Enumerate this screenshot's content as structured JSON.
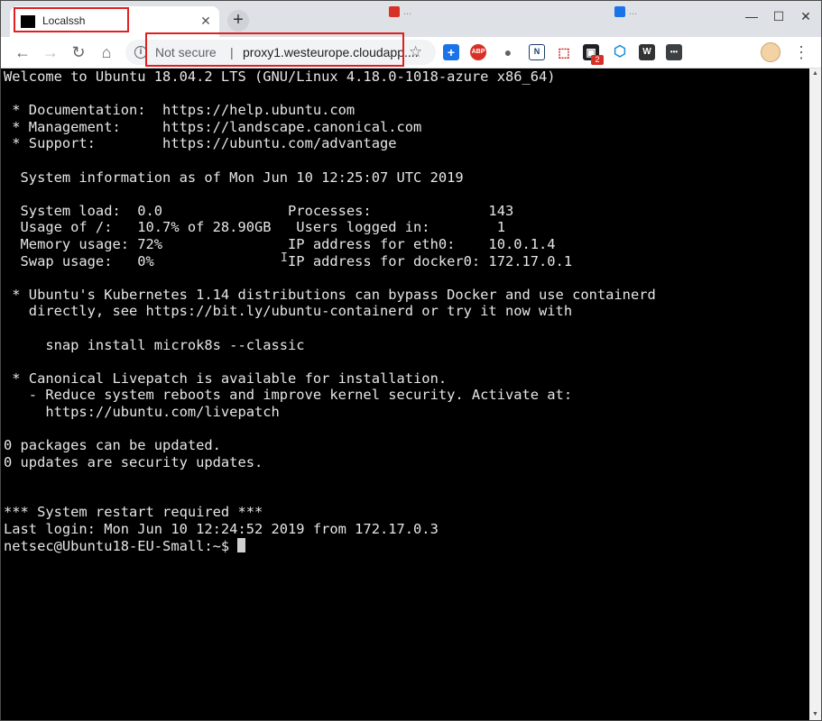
{
  "browser": {
    "active_tab": {
      "title": "Localssh",
      "close_label": "✕"
    },
    "new_tab_label": "+",
    "background_tabs": [
      {
        "title": "...",
        "color": "#d93025"
      },
      {
        "title": "...",
        "color": "#1a73e8"
      }
    ],
    "window_controls": {
      "minimize": "—",
      "maximize": "☐",
      "close": "✕"
    },
    "nav": {
      "back": "←",
      "forward": "→",
      "reload": "↻",
      "home": "⌂"
    },
    "omnibox": {
      "security_label": "Not secure",
      "separator": "|",
      "url": "proxy1.westeurope.cloudapp....",
      "bookmark_icon": "☆"
    },
    "extensions": [
      {
        "name": "add-extension-icon",
        "label": "+",
        "color": "#1a73e8"
      },
      {
        "name": "adblock-icon",
        "label": "ABP",
        "color": "#d93025"
      },
      {
        "name": "circle-extension-icon",
        "label": "●",
        "color": "#5f6368"
      },
      {
        "name": "n-extension-icon",
        "label": "N",
        "color": "#1a3d6d"
      },
      {
        "name": "pdf-extension-icon",
        "label": "⬚",
        "color": "#c5221f"
      },
      {
        "name": "dark-extension-icon",
        "label": "▣",
        "color": "#202124"
      },
      {
        "name": "hex-extension-icon",
        "label": "⬡",
        "color": "#1a8fd6"
      },
      {
        "name": "text-extension-icon",
        "label": "W",
        "color": "#333333"
      },
      {
        "name": "dots-extension-icon",
        "label": "•••",
        "color": "#3c4043"
      }
    ],
    "badge_count": "2",
    "menu_label": "⋮"
  },
  "terminal": {
    "lines": [
      "Welcome to Ubuntu 18.04.2 LTS (GNU/Linux 4.18.0-1018-azure x86_64)",
      "",
      " * Documentation:  https://help.ubuntu.com",
      " * Management:     https://landscape.canonical.com",
      " * Support:        https://ubuntu.com/advantage",
      "",
      "  System information as of Mon Jun 10 12:25:07 UTC 2019",
      "",
      "  System load:  0.0               Processes:              143",
      "  Usage of /:   10.7% of 28.90GB   Users logged in:        1",
      "  Memory usage: 72%               IP address for eth0:    10.0.1.4",
      "  Swap usage:   0%                IP address for docker0: 172.17.0.1",
      "",
      " * Ubuntu's Kubernetes 1.14 distributions can bypass Docker and use containerd",
      "   directly, see https://bit.ly/ubuntu-containerd or try it now with",
      "",
      "     snap install microk8s --classic",
      "",
      " * Canonical Livepatch is available for installation.",
      "   - Reduce system reboots and improve kernel security. Activate at:",
      "     https://ubuntu.com/livepatch",
      "",
      "0 packages can be updated.",
      "0 updates are security updates.",
      "",
      "",
      "*** System restart required ***",
      "Last login: Mon Jun 10 12:24:52 2019 from 172.17.0.3"
    ],
    "prompt": "netsec@Ubuntu18-EU-Small:~$ "
  }
}
